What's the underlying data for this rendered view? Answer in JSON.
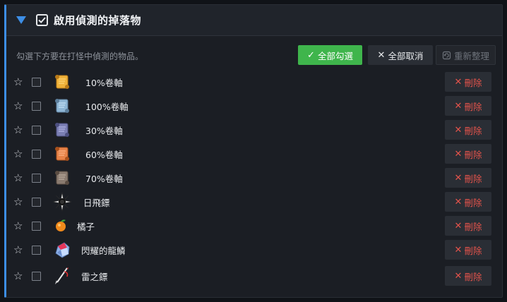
{
  "header": {
    "title": "啟用偵測的掉落物"
  },
  "hint": "勾選下方要在打怪中偵測的物品。",
  "buttons": {
    "select_all": {
      "icon": "✓",
      "label": "全部勾選"
    },
    "cancel_all": {
      "icon": "✕",
      "label": "全部取消"
    },
    "reorder": {
      "label": "重新整理"
    }
  },
  "delete_label": "刪除",
  "delete_icon": "✕",
  "star_glyph": "☆",
  "items": [
    {
      "name": "10%卷軸",
      "icon": "scroll-gold-icon"
    },
    {
      "name": "100%卷軸",
      "icon": "scroll-blue-icon"
    },
    {
      "name": "30%卷軸",
      "icon": "scroll-purple-icon"
    },
    {
      "name": "60%卷軸",
      "icon": "scroll-orange-icon"
    },
    {
      "name": "70%卷軸",
      "icon": "scroll-brown-icon"
    },
    {
      "name": "日飛鏢",
      "icon": "sun-star-icon"
    },
    {
      "name": "橘子",
      "icon": "orange-icon"
    },
    {
      "name": "閃耀的龍鱗",
      "icon": "dragon-scale-icon"
    },
    {
      "name": "雷之鏢",
      "icon": "thunder-dart-icon"
    }
  ],
  "colors": {
    "accent": "#3d8ee6",
    "select_all_bg": "#3fb54c",
    "delete_text": "#e2534b",
    "panel_bg": "#1b1e24"
  }
}
